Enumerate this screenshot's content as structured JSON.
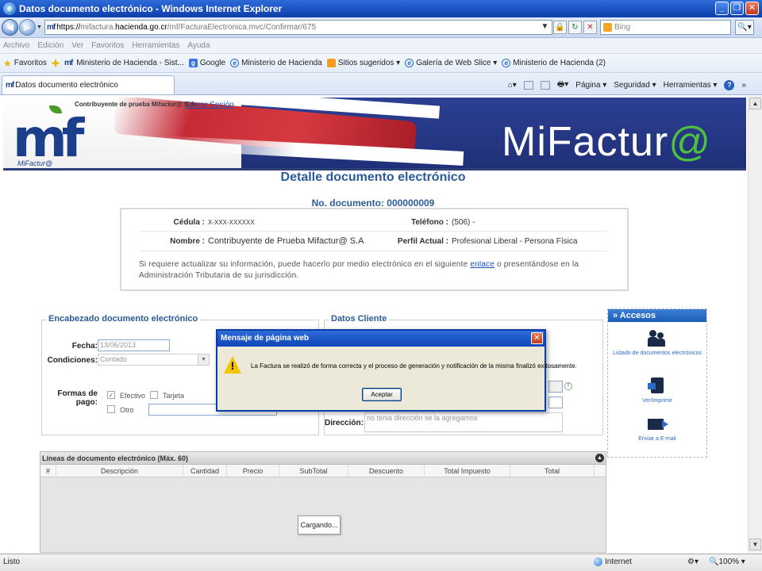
{
  "window": {
    "title": "Datos documento electrónico - Windows Internet Explorer",
    "buttons": [
      "_",
      "❐",
      "✕"
    ]
  },
  "address": {
    "url_scheme": "https://",
    "url_gray1": "mifactura.",
    "url_host": "hacienda.go.cr",
    "url_gray2": "/mf/FacturaElectronica.mvc/Confirmar/675",
    "search_placeholder": "Bing"
  },
  "menu": [
    "Archivo",
    "Edición",
    "Ver",
    "Favoritos",
    "Herramientas",
    "Ayuda"
  ],
  "favorites": {
    "label": "Favoritos",
    "items": [
      {
        "icon": "mf-icon",
        "label": "Ministerio de Hacienda - Sist..."
      },
      {
        "icon": "google-icon",
        "label": "Google"
      },
      {
        "icon": "ie-icon",
        "label": "Ministerio de Hacienda"
      },
      {
        "icon": "orange-icon",
        "label": "Sitios sugeridos ▾"
      },
      {
        "icon": "ie-icon",
        "label": "Galería de Web Slice ▾"
      },
      {
        "icon": "ie-icon",
        "label": "Ministerio de Hacienda (2)"
      }
    ]
  },
  "tab": {
    "label": "Datos documento electrónico"
  },
  "commands": [
    "Página ▾",
    "Seguridad ▾",
    "Herramientas ▾"
  ],
  "header": {
    "taxpayer": "Contribuyente de prueba Mifactur@ S.A.",
    "logout": "Cerrar Sesión",
    "brand_main": "MiFactur",
    "brand_at": "@",
    "logo_letters": "mf",
    "logo_sub": "MiFactur@"
  },
  "page": {
    "title": "Detalle documento electrónico",
    "doc_number": "No. documento: 000000009"
  },
  "info": {
    "cedula_label": "Cédula :",
    "cedula_value": "X-XXX-XXXXXX",
    "telefono_label": "Teléfono :",
    "telefono_value": "(506) -",
    "nombre_label": "Nombre :",
    "nombre_value": "Contribuyente de Prueba Mifactur@ S.A",
    "perfil_label": "Perfil Actual :",
    "perfil_value": "Profesional Liberal - Persona Física",
    "msg_before": "Si requiere actualizar su información, puede hacerlo por medio electrónico en el siguiente ",
    "msg_link": "enlace",
    "msg_after": " o presentándose en la Administración Tributaria de su jurisdicción."
  },
  "encabezado": {
    "legend": "Encabezado documento electrónico",
    "fecha_label": "Fecha:",
    "fecha_value": "13/06/2013",
    "condiciones_label": "Condiciones:",
    "condiciones_value": "Contado",
    "formas_label": "Formas de pago:",
    "efectivo": "Efectivo",
    "tarjeta": "Tarjeta",
    "otro": "Otro"
  },
  "cliente": {
    "legend": "Datos Cliente",
    "direccion_label": "Dirección:",
    "direccion_value": "no tenia dirección se la agregamos"
  },
  "accesos": {
    "title": "Accesos",
    "items": [
      {
        "label": "Listado de documentos electrónicos"
      },
      {
        "label": "Ver/Imprimir"
      },
      {
        "label": "Enviar a E-mail"
      }
    ]
  },
  "lines": {
    "title": "Líneas de documento electrónico (Máx. 60)",
    "columns": [
      "#",
      "Descripción",
      "Cantidad",
      "Precio",
      "SubTotal",
      "Descuento",
      "Total Impuesto",
      "Total"
    ],
    "loading": "Cargando..."
  },
  "dialog": {
    "title": "Mensaje de página web",
    "message": "La Factura se realizó de forma correcta y el proceso de generación y notificación de la misma finalizó exitosamente.",
    "ok": "Aceptar"
  },
  "status": {
    "left": "Listo",
    "zone": "Internet",
    "zoom": "100%"
  }
}
